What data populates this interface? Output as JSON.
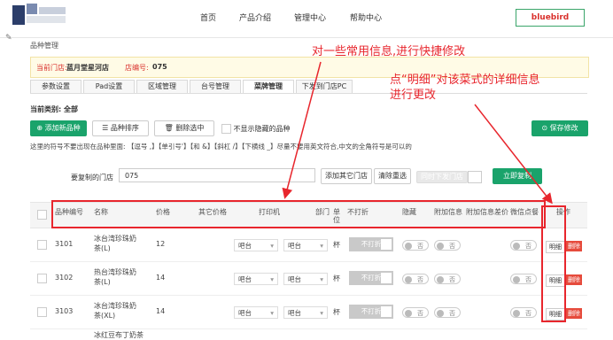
{
  "nav": {
    "items": [
      "首页",
      "产品介绍",
      "管理中心",
      "帮助中心"
    ],
    "user": "bluebird"
  },
  "breadcrumb": "品种管理",
  "store": {
    "label": "当前门店:",
    "name": "蓝月堂星河店",
    "code_label": "店编号:",
    "code": "075"
  },
  "tabs": [
    "参数设置",
    "Pad设置",
    "区域管理",
    "台号管理",
    "菜牌管理",
    "下发到门店PC"
  ],
  "category": "当前类别: 全部",
  "toolbar": {
    "add": "添加新品种",
    "sort": "品种排序",
    "delete": "删除选中",
    "show_hidden": "不显示隐藏的品种",
    "save": "保存修改"
  },
  "hint": "这里的符号不要出现在品种里面: 【逗号 ,】【单引号'】【和 &】【斜杠 /】【下横线 _】尽量不要用英文符合,中文的全角符号是可以的",
  "copy": {
    "label": "要复制的门店",
    "value": "075",
    "add_other": "添加其它门店",
    "clear": "清除重选",
    "sync": "同时下发门店",
    "copy_now": "立即复制"
  },
  "columns": [
    "品种编号",
    "名称",
    "价格",
    "其它价格",
    "打印机",
    "部门",
    "单位",
    "不打折",
    "隐藏",
    "附加信息",
    "附加信息差价",
    "微信点餐",
    "操作"
  ],
  "rows": [
    {
      "code": "3101",
      "name": "冰台湾珍珠奶茶(L)",
      "price": "12",
      "printer1": "吧台",
      "printer2": "吧台",
      "unit": "杯",
      "noprint": "不打折",
      "hide": "否",
      "extra": "否",
      "wechat": "否",
      "detail": "明细",
      "del": "删除"
    },
    {
      "code": "3102",
      "name": "热台湾珍珠奶茶(L)",
      "price": "14",
      "printer1": "吧台",
      "printer2": "吧台",
      "unit": "杯",
      "noprint": "不打折",
      "hide": "否",
      "extra": "否",
      "wechat": "否",
      "detail": "明细",
      "del": "删除"
    },
    {
      "code": "3103",
      "name": "冰台湾珍珠奶茶(XL)",
      "price": "14",
      "printer1": "吧台",
      "printer2": "吧台",
      "unit": "杯",
      "noprint": "不打折",
      "hide": "否",
      "extra": "否",
      "wechat": "否",
      "detail": "明细",
      "del": "删除"
    }
  ],
  "partial_row_name": "冰红豆布丁奶茶",
  "annotations": {
    "a1": "对一些常用信息,进行快捷修改",
    "a2_line1": "点“明细”对该菜式的详细信息",
    "a2_line2": "进行更改"
  },
  "colors": {
    "accent": "#1aa36b",
    "annotation": "#e8262d"
  }
}
